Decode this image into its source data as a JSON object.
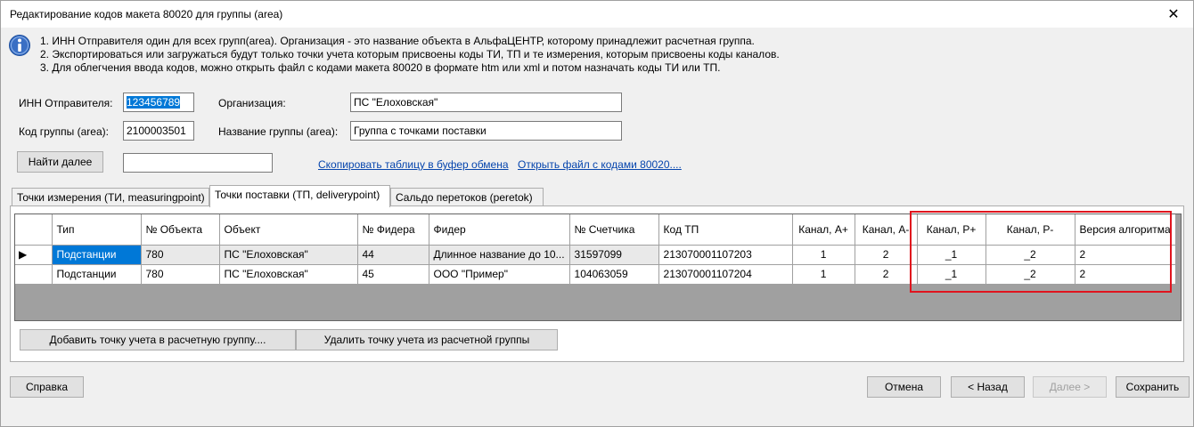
{
  "window": {
    "title": "Редактирование кодов макета 80020 для группы (area)",
    "close_glyph": "✕"
  },
  "info": {
    "icon": "info-icon",
    "lines": [
      "1. ИНН Отправителя один для всех групп(area). Организация - это название объекта в АльфаЦЕНТР, которому принадлежит расчетная группа.",
      "2. Экспортироваться или загружаться будут только точки учета которым присвоены коды ТИ, ТП и те измерения, которым присвоены коды каналов.",
      "3. Для облегчения ввода кодов, можно открыть файл с кодами макета 80020 в формате htm или xml и потом назначать коды ТИ или ТП."
    ]
  },
  "form": {
    "inn_label": "ИНН Отправителя:",
    "inn_value": "123456789",
    "org_label": "Организация:",
    "org_value": "ПС \"Елоховская\"",
    "group_code_label": "Код группы (area):",
    "group_code_value": "2100003501",
    "group_name_label": "Название группы (area):",
    "group_name_value": "Группа с точками поставки",
    "find_next_label": "Найти далее",
    "search_value": "",
    "copy_link": "Скопировать таблицу в буфер обмена",
    "open_link": "Открыть файл с кодами 80020...."
  },
  "tabs": [
    "Точки измерения (ТИ, measuringpoint)",
    "Точки поставки (ТП, deliverypoint)",
    "Сальдо перетоков (peretok)"
  ],
  "table": {
    "columns": [
      "Тип",
      "№ Объекта",
      "Объект",
      "№ Фидера",
      "Фидер",
      "№ Счетчика",
      "Код ТП",
      "Канал, А+",
      "Канал, А-",
      "Канал, Р+",
      "Канал, Р-",
      "Версия алгоритма"
    ],
    "rows": [
      [
        "Подстанции",
        "780",
        "ПС \"Елоховская\"",
        "44",
        "Длинное название до 10...",
        "31597099",
        "213070001107203",
        "1",
        "2",
        "_1",
        "_2",
        "2"
      ],
      [
        "Подстанции",
        "780",
        "ПС \"Елоховская\"",
        "45",
        "ООО \"Пример\"",
        "104063059",
        "213070001107204",
        "1",
        "2",
        "_1",
        "_2",
        "2"
      ]
    ],
    "current_row_marker": "▶"
  },
  "buttons": {
    "add_point": "Добавить точку учета в расчетную группу....",
    "remove_point": "Удалить точку учета из расчетной группы",
    "help": "Справка",
    "cancel": "Отмена",
    "back": "< Назад",
    "next": "Далее >",
    "save": "Сохранить"
  },
  "colors": {
    "selection": "#0078d7",
    "highlight_box": "#e0141e",
    "link": "#0645ad"
  }
}
